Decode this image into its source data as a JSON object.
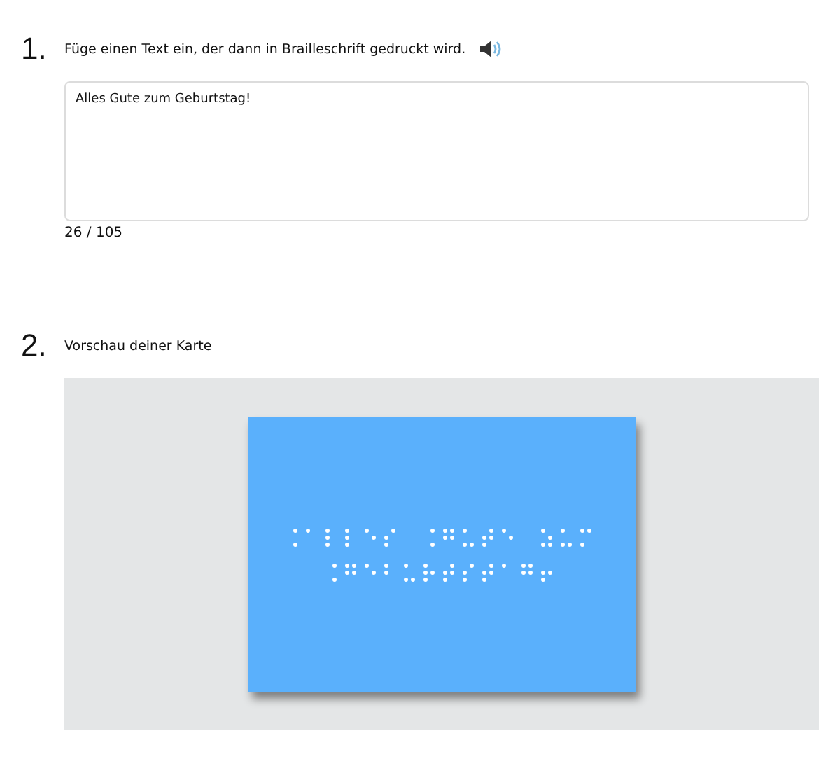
{
  "steps": [
    {
      "number": "1.",
      "title": "Füge einen Text ein, der dann in Brailleschrift gedruckt wird.",
      "kind": "input"
    },
    {
      "number": "2.",
      "title": "Vorschau deiner Karte",
      "kind": "preview"
    }
  ],
  "input": {
    "value": "Alles Gute zum Geburtstag!",
    "counter": "26 / 105"
  }
}
